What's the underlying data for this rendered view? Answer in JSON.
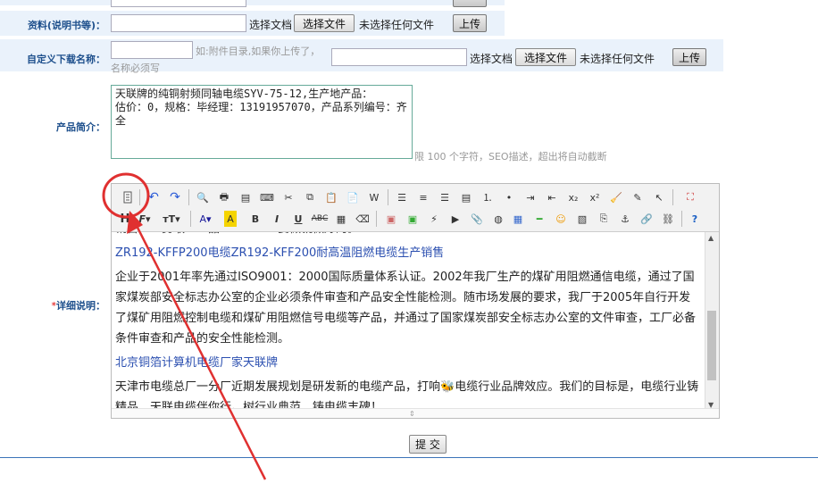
{
  "form": {
    "docs_label": "资料(说明书等)：",
    "choose_doc": "选择文档",
    "choose_file_btn": "选择文件",
    "no_file": "未选择任何文件",
    "upload_btn": "上传",
    "custom_label": "自定义下载名称：",
    "custom_hint": "如:附件目录,如果你上传了，",
    "name_required": "名称必须写",
    "intro_label": "产品简介：",
    "intro_text": "天联牌的纯铜射频同轴电缆SYV-75-12,生产地产品：\n估价：0，规格：毕经理：13191957070，产品系列编号：齐全",
    "intro_hint": "限 100 个字符，SEO描述，超出将自动截断",
    "detail_label": "详细说明：",
    "required_mark": "*",
    "submit": "提 交"
  },
  "editor": {
    "cut_line": "销售……勇敢……品……………要做就做好的。",
    "link1": "ZR192-KFFP200电缆ZR192-KFF200耐高温阻燃电缆生产销售",
    "para1": "企业于2001年率先通过ISO9001：2000国际质量体系认证。2002年我厂生产的煤矿用阻燃通信电缆，通过了国家煤炭部安全标志办公室的企业必须条件审查和产品安全性能检测。随市场发展的要求，我厂于2005年自行开发了煤矿用阻燃控制电缆和煤矿用阻燃信号电缆等产品，并通过了国家煤炭部安全标志办公室的文件审查，工厂必备条件审查和产品的安全性能检测。",
    "link2": "北京铜箔计算机电缆厂家天联牌",
    "para2a": "天津市电缆总厂一分厂近期发展规划是研发新的电缆产品，打响",
    "para2b": "电缆行业品牌效应。我们的目标是，电缆行业铸精品，天联电缆伴你行。树行业典范，铸电缆丰碑！"
  },
  "annotation": {
    "color": "#e03030"
  }
}
